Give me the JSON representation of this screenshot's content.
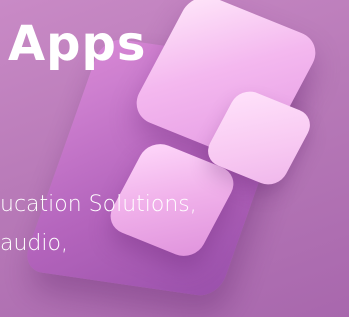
{
  "hero": {
    "title": "Apps",
    "lines": [
      "ucation Solutions,",
      "audio,"
    ]
  }
}
